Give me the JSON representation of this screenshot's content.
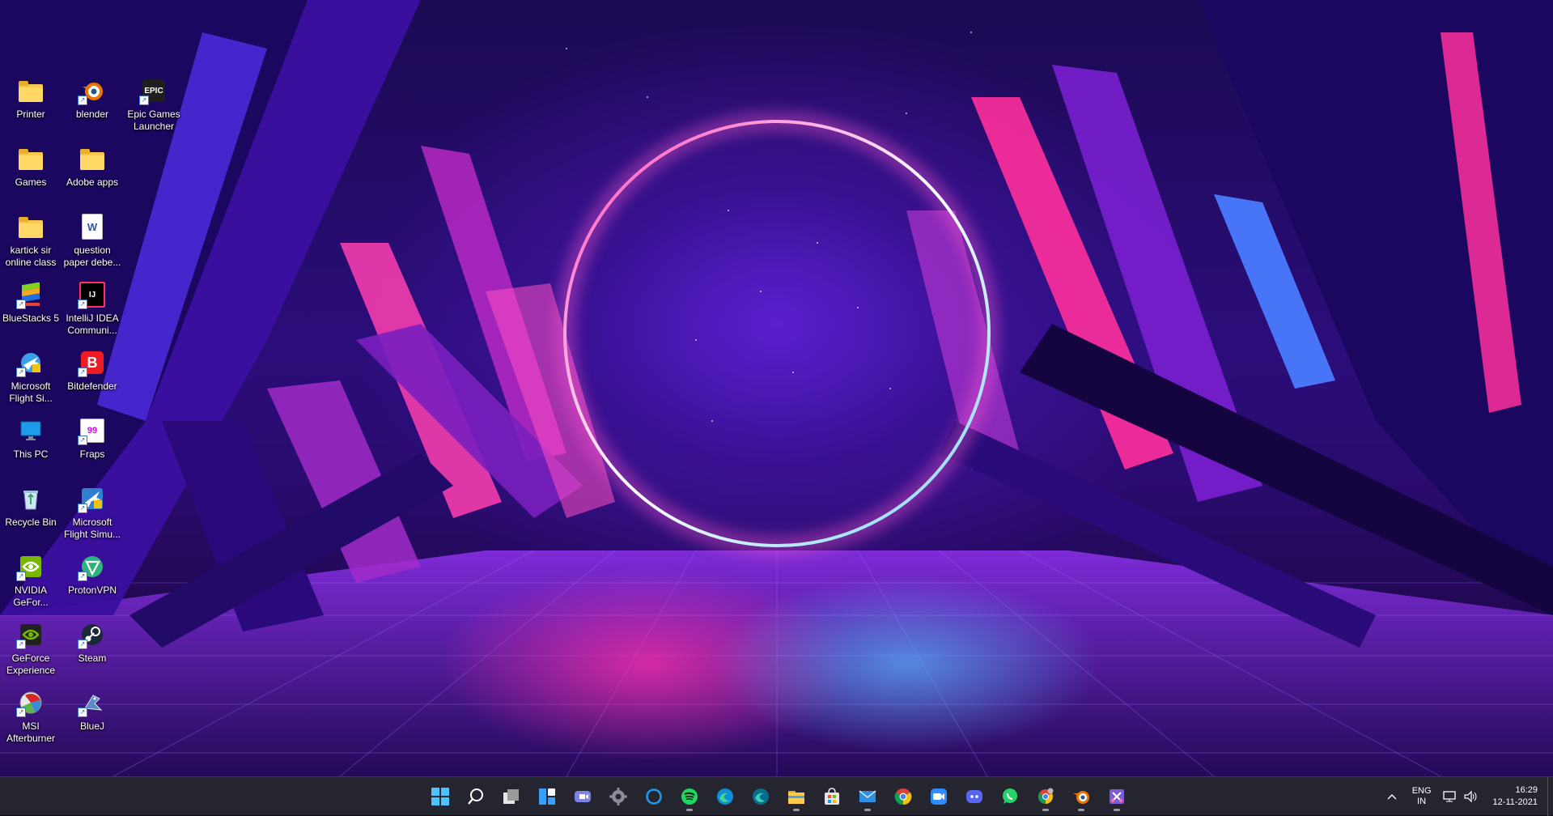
{
  "desktop": {
    "icons": [
      {
        "label": "Printer",
        "icon": "folder-icon"
      },
      {
        "label": "blender",
        "icon": "blender-icon"
      },
      {
        "label": "Epic Games Launcher",
        "icon": "epic-games-icon",
        "logo_text": "EPIC"
      },
      {
        "label": "Games",
        "icon": "folder-icon"
      },
      {
        "label": "Adobe apps",
        "icon": "folder-icon"
      },
      {
        "label": "kartick sir online class",
        "icon": "folder-icon"
      },
      {
        "label": "question paper debe...",
        "icon": "word-document-icon",
        "logo_text": "W"
      },
      {
        "label": "BlueStacks 5",
        "icon": "bluestacks-icon"
      },
      {
        "label": "IntelliJ IDEA Communi...",
        "icon": "intellij-icon",
        "logo_text": "IJ"
      },
      {
        "label": "Microsoft Flight Si...",
        "icon": "flight-simulator-icon"
      },
      {
        "label": "Bitdefender",
        "icon": "bitdefender-icon",
        "logo_text": "B"
      },
      {
        "label": "This PC",
        "icon": "monitor-icon"
      },
      {
        "label": "Fraps",
        "icon": "fraps-icon",
        "logo_text": "99"
      },
      {
        "label": "Recycle Bin",
        "icon": "recycle-bin-icon"
      },
      {
        "label": "Microsoft Flight Simu...",
        "icon": "flight-simulator-icon"
      },
      {
        "label": "NVIDIA GeFor...",
        "icon": "nvidia-icon"
      },
      {
        "label": "ProtonVPN",
        "icon": "protonvpn-icon"
      },
      {
        "label": "GeForce Experience",
        "icon": "geforce-icon"
      },
      {
        "label": "Steam",
        "icon": "steam-icon"
      },
      {
        "label": "MSI Afterburner",
        "icon": "msi-afterburner-icon"
      },
      {
        "label": "BlueJ",
        "icon": "bluej-icon"
      }
    ]
  },
  "taskbar": {
    "apps": [
      {
        "name": "Start",
        "icon": "windows-start-icon"
      },
      {
        "name": "Search",
        "icon": "search-icon"
      },
      {
        "name": "Task View",
        "icon": "task-view-icon"
      },
      {
        "name": "Widgets",
        "icon": "widgets-icon"
      },
      {
        "name": "Teams Chat",
        "icon": "teams-chat-icon"
      },
      {
        "name": "Settings",
        "icon": "gear-icon"
      },
      {
        "name": "Cortana",
        "icon": "cortana-icon"
      },
      {
        "name": "Spotify",
        "icon": "spotify-icon",
        "running": true
      },
      {
        "name": "Edge",
        "icon": "edge-icon"
      },
      {
        "name": "Edge Dev",
        "icon": "edge-dev-icon"
      },
      {
        "name": "File Explorer",
        "icon": "file-explorer-icon",
        "running": true
      },
      {
        "name": "Microsoft Store",
        "icon": "store-icon"
      },
      {
        "name": "Mail",
        "icon": "mail-icon",
        "running": true
      },
      {
        "name": "Chrome",
        "icon": "chrome-icon"
      },
      {
        "name": "Zoom",
        "icon": "zoom-icon"
      },
      {
        "name": "Discord",
        "icon": "discord-icon"
      },
      {
        "name": "WhatsApp",
        "icon": "whatsapp-icon"
      },
      {
        "name": "Chrome Profile",
        "icon": "chrome-profile-icon",
        "running": true
      },
      {
        "name": "Blender",
        "icon": "blender-icon",
        "running": true
      },
      {
        "name": "Snipping Tool",
        "icon": "snipping-tool-icon",
        "running": true
      }
    ],
    "tray": {
      "lang_line1": "ENG",
      "lang_line2": "IN",
      "time": "16:29",
      "date": "12-11-2021"
    }
  },
  "colors": {
    "taskbar_bg": "#252530",
    "ring_glow": "#ff5bd0",
    "ring_glow_2": "#7fd8ff"
  }
}
